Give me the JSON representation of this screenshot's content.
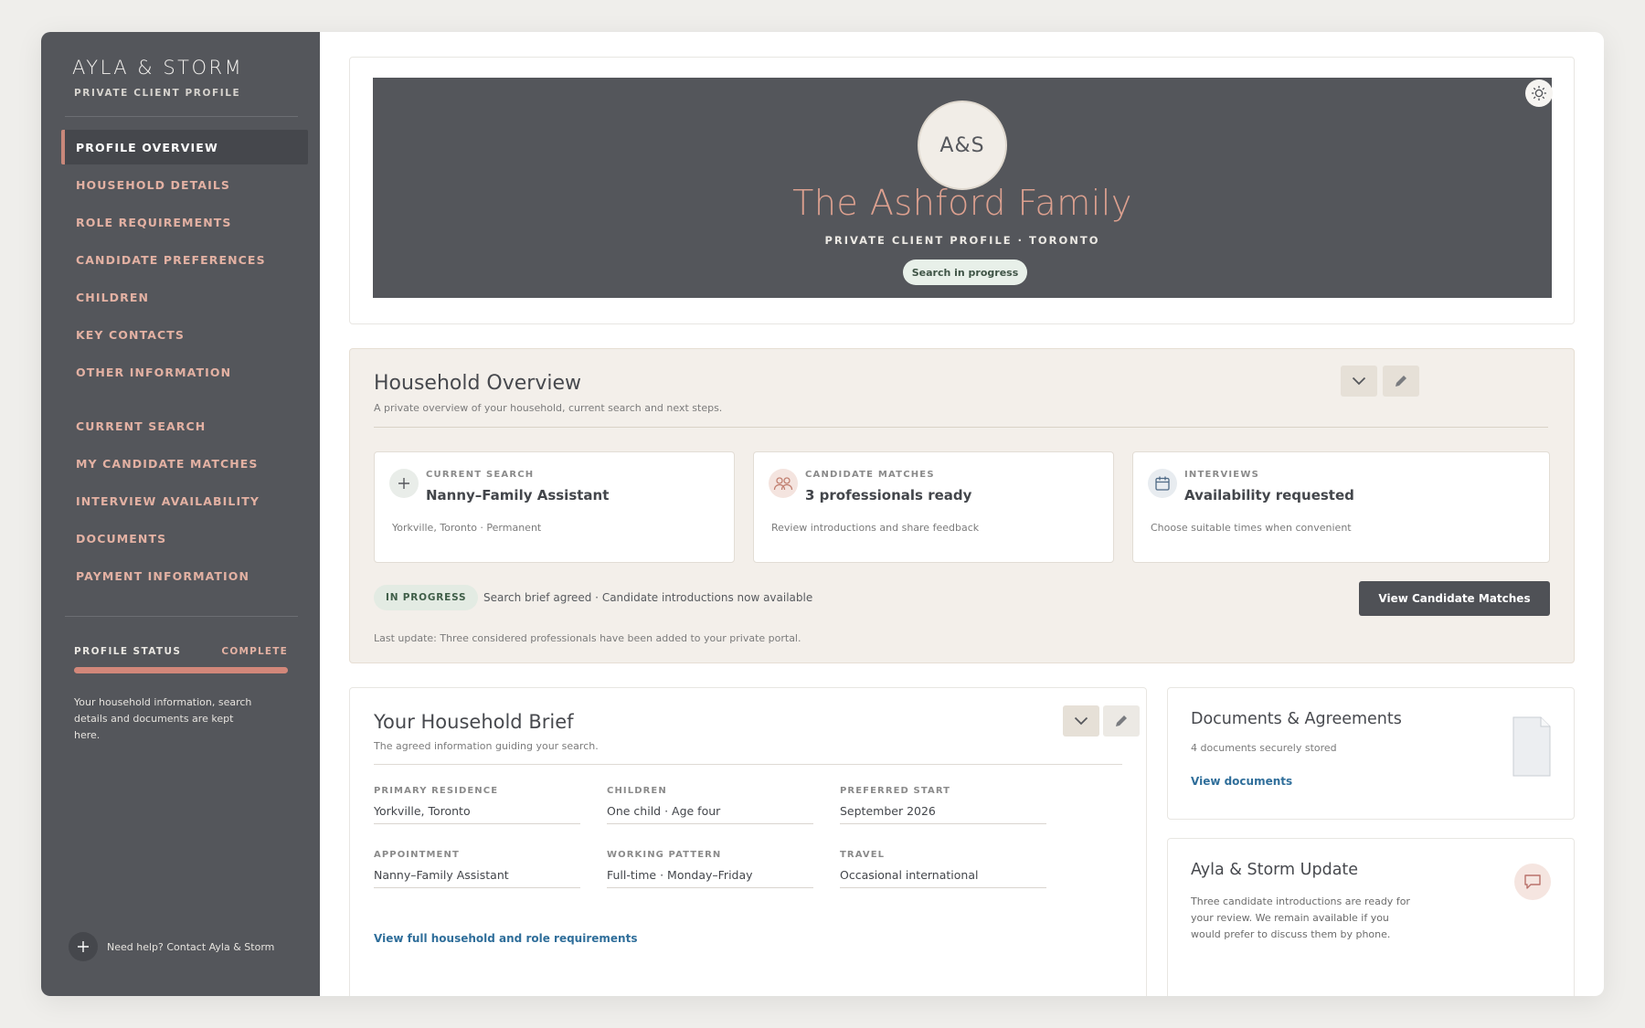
{
  "sidebar": {
    "brand": "AYLA & STORM",
    "brand_sub": "PRIVATE CLIENT PROFILE",
    "nav": [
      "PROFILE OVERVIEW",
      "HOUSEHOLD DETAILS",
      "ROLE REQUIREMENTS",
      "CANDIDATE PREFERENCES",
      "CHILDREN",
      "KEY CONTACTS",
      "OTHER INFORMATION",
      "CURRENT SEARCH",
      "MY CANDIDATE MATCHES",
      "INTERVIEW AVAILABILITY",
      "DOCUMENTS",
      "PAYMENT INFORMATION"
    ],
    "active_item": "PROFILE OVERVIEW",
    "profile_status_label": "PROFILE STATUS",
    "profile_status_value": "COMPLETE",
    "profile_completion": 1.0,
    "status_note": "Your household information, search details and documents are kept here.",
    "help_text": "Need help? Contact Ayla & Storm"
  },
  "hero": {
    "monogram": "A&S",
    "family_name": "The Ashford Family",
    "subtitle": "PRIVATE CLIENT PROFILE · TORONTO",
    "status_pill": "Search in progress"
  },
  "overview": {
    "title": "Household Overview",
    "description": "A private overview of your household, current search and next steps.",
    "cards": [
      {
        "label": "CURRENT SEARCH",
        "title": "Nanny–Family Assistant",
        "desc": "Yorkville, Toronto · Permanent",
        "icon": "plus-icon"
      },
      {
        "label": "CANDIDATE MATCHES",
        "title": "3 professionals ready",
        "desc": "Review introductions and share feedback",
        "icon": "people-icon"
      },
      {
        "label": "INTERVIEWS",
        "title": "Availability requested",
        "desc": "Choose suitable times when convenient",
        "icon": "calendar-icon"
      }
    ],
    "badge": "IN PROGRESS",
    "progress_text": "Search brief agreed · Candidate introductions now available",
    "button": "View Candidate Matches",
    "last_update": "Last update: Three considered professionals have been added to your private portal."
  },
  "brief": {
    "title": "Your Household Brief",
    "description": "The agreed information guiding your search.",
    "fields": [
      {
        "label": "PRIMARY RESIDENCE",
        "value": "Yorkville, Toronto"
      },
      {
        "label": "CHILDREN",
        "value": "One child · Age four"
      },
      {
        "label": "PREFERRED START",
        "value": "September 2026"
      },
      {
        "label": "APPOINTMENT",
        "value": "Nanny–Family Assistant"
      },
      {
        "label": "WORKING PATTERN",
        "value": "Full-time · Monday–Friday"
      },
      {
        "label": "TRAVEL",
        "value": "Occasional international"
      }
    ],
    "link": "View full household and role requirements"
  },
  "documents": {
    "title": "Documents & Agreements",
    "subtitle": "4 documents securely stored",
    "link": "View documents"
  },
  "update": {
    "title": "Ayla & Storm Update",
    "text": "Three candidate introductions are ready for your review. We remain available if you would prefer to discuss them by phone."
  },
  "colors": {
    "sidebar": "#54565b",
    "accent": "#dca08f",
    "link": "#2f6e9a",
    "overview_bg": "#f3efea"
  }
}
